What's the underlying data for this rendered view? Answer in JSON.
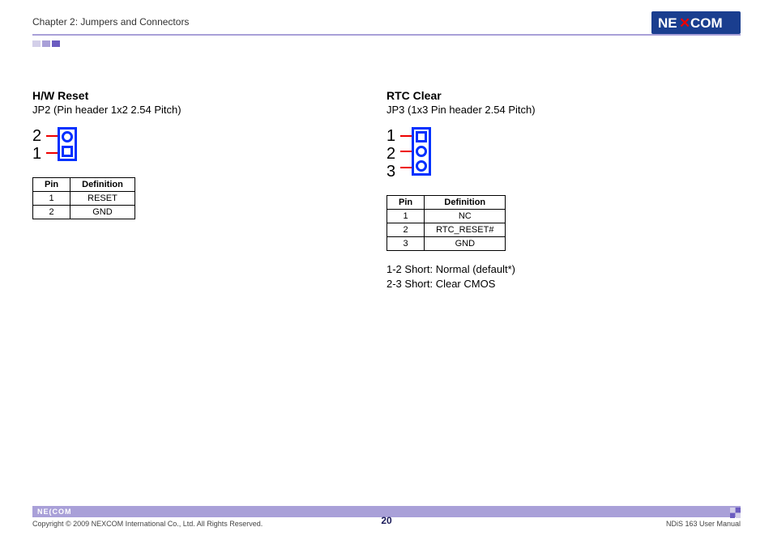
{
  "header": {
    "chapter": "Chapter 2: Jumpers and Connectors",
    "brand": "NEXCOM"
  },
  "left": {
    "title": "H/W Reset",
    "sub": "JP2 (Pin header 1x2 2.54 Pitch)",
    "pins_graphic": [
      "2",
      "1"
    ],
    "table": {
      "headers": [
        "Pin",
        "Definition"
      ],
      "rows": [
        [
          "1",
          "RESET"
        ],
        [
          "2",
          "GND"
        ]
      ]
    }
  },
  "right": {
    "title": "RTC Clear",
    "sub": "JP3 (1x3 Pin header 2.54 Pitch)",
    "pins_graphic": [
      "1",
      "2",
      "3"
    ],
    "table": {
      "headers": [
        "Pin",
        "Definition"
      ],
      "rows": [
        [
          "1",
          "NC"
        ],
        [
          "2",
          "RTC_RESET#"
        ],
        [
          "3",
          "GND"
        ]
      ]
    },
    "notes": [
      "1-2 Short: Normal (default*)",
      "2-3 Short: Clear CMOS"
    ]
  },
  "footer": {
    "brand_small": "NE(COM",
    "copyright": "Copyright © 2009 NEXCOM International Co., Ltd. All Rights Reserved.",
    "page": "20",
    "manual": "NDiS 163 User Manual"
  }
}
